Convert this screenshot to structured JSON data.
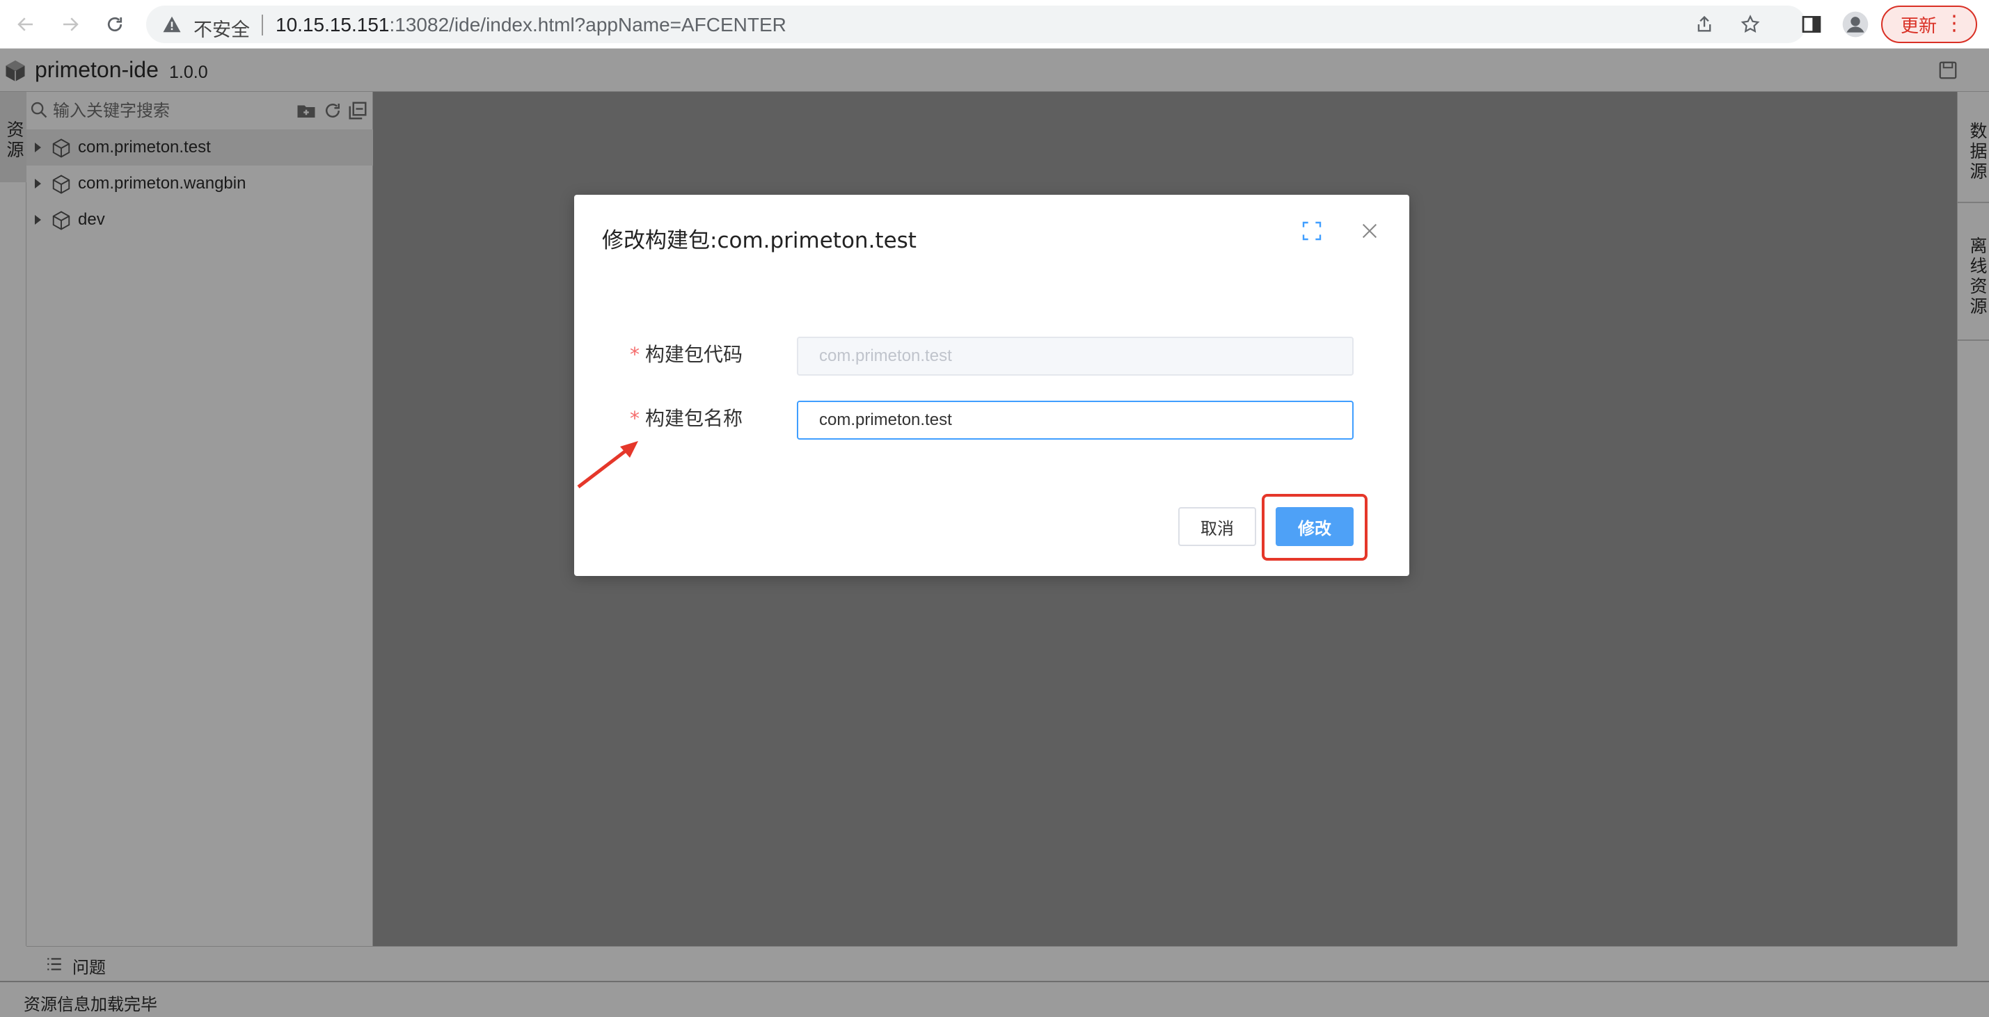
{
  "browser": {
    "insecure_label": "不安全",
    "url_host": "10.15.15.151",
    "url_rest": ":13082/ide/index.html?appName=AFCENTER",
    "update_label": "更新"
  },
  "ide": {
    "title": "primeton-ide",
    "version": "1.0.0"
  },
  "left_rail": {
    "tab_label": "资源"
  },
  "resource_panel": {
    "search_placeholder": "输入关键字搜索",
    "tree": [
      {
        "label": "com.primeton.test"
      },
      {
        "label": "com.primeton.wangbin"
      },
      {
        "label": "dev"
      }
    ]
  },
  "right_rail": {
    "tabs": [
      {
        "label": "数据源"
      },
      {
        "label": "离线资源"
      }
    ]
  },
  "problems": {
    "label": "问题"
  },
  "status": {
    "text": "资源信息加载完毕"
  },
  "dialog": {
    "title": "修改构建包:com.primeton.test",
    "fields": [
      {
        "required_mark": "*",
        "label": "构建包代码",
        "value": "com.primeton.test",
        "disabled": true
      },
      {
        "required_mark": "*",
        "label": "构建包名称",
        "value": "com.primeton.test",
        "disabled": false
      }
    ],
    "cancel_label": "取消",
    "confirm_label": "修改"
  },
  "colors": {
    "primary": "#4ea1f7",
    "annotation_red": "#e5372a",
    "required": "#f56c6c",
    "ide_gray": "#9b9b9b",
    "editor_gray": "#5f5f5f"
  }
}
